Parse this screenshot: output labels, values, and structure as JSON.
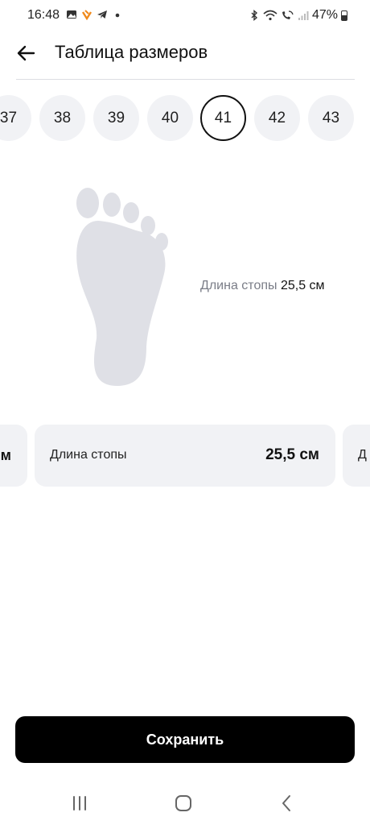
{
  "status": {
    "time": "16:48",
    "battery": "47%",
    "icons": [
      "gallery-icon",
      "app-notification-icon",
      "telegram-icon",
      "dot-icon",
      "bluetooth-icon",
      "wifi-icon",
      "wifi-calling-icon",
      "signal-icon",
      "battery-icon"
    ]
  },
  "header": {
    "title": "Таблица размеров"
  },
  "sizes": {
    "items": [
      "37",
      "38",
      "39",
      "40",
      "41",
      "42",
      "43"
    ],
    "selected": "41"
  },
  "foot": {
    "label": "Длина стопы",
    "value": "25,5 см"
  },
  "cards": {
    "left_value": "м",
    "main_label": "Длина стопы",
    "main_value": "25,5 см",
    "right_label": "Д"
  },
  "save_label": "Сохранить",
  "nav": [
    "recents-icon",
    "home-icon",
    "back-icon"
  ]
}
